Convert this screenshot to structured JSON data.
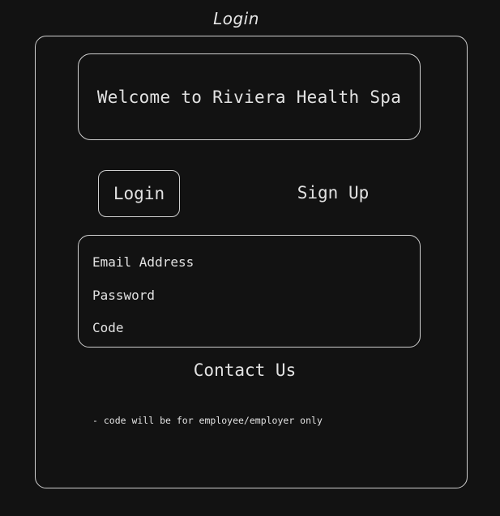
{
  "frame": {
    "title": "Login"
  },
  "header": {
    "welcome": "Welcome to Riviera Health Spa"
  },
  "tabs": {
    "login_label": "Login",
    "signup_label": "Sign Up"
  },
  "form": {
    "email_label": "Email Address",
    "password_label": "Password",
    "code_label": "Code"
  },
  "footer": {
    "contact_label": "Contact Us",
    "note": "- code will be for employee/employer only"
  },
  "colors": {
    "background": "#121212",
    "stroke": "#cfcfcf",
    "text": "#e2e2e2"
  }
}
